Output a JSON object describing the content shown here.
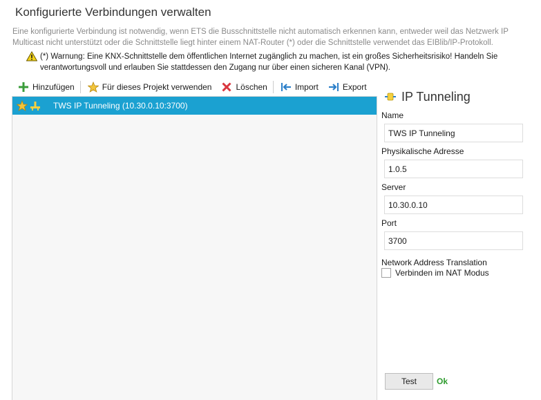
{
  "page": {
    "title": "Konfigurierte Verbindungen verwalten",
    "description": "Eine konfigurierte Verbindung ist notwendig, wenn ETS die Busschnittstelle nicht automatisch erkennen kann, entweder weil das Netzwerk IP Multicast nicht unterstützt oder die Schnittstelle liegt hinter einem NAT-Router (*) oder die Schnittstelle verwendet das EIBlib/IP-Protokoll.",
    "warning": "(*) Warnung: Eine KNX-Schnittstelle dem öffentlichen Internet zugänglich zu machen, ist ein großes Sicherheitsrisiko! Handeln Sie verantwortungsvoll und erlauben Sie stattdessen den Zugang nur über einen sicheren Kanal (VPN)."
  },
  "toolbar": {
    "add": "Hinzufügen",
    "use_for_project": "Für dieses Projekt verwenden",
    "delete": "Löschen",
    "import": "Import",
    "export": "Export"
  },
  "connections": [
    {
      "label": "TWS IP Tunneling (10.30.0.10:3700)",
      "selected": true,
      "is_favorite": true
    }
  ],
  "details": {
    "title": "IP Tunneling",
    "name_label": "Name",
    "name_value": "TWS IP Tunneling",
    "phys_label": "Physikalische Adresse",
    "phys_value": "1.0.5",
    "server_label": "Server",
    "server_value": "10.30.0.10",
    "port_label": "Port",
    "port_value": "3700",
    "nat_label": "Network Address Translation",
    "nat_checkbox_label": "Verbinden im NAT Modus",
    "nat_checked": false,
    "test_button": "Test",
    "test_result": "Ok"
  },
  "colors": {
    "selection": "#1ba1d1",
    "ok_green": "#2e9b2e",
    "add_green": "#3a9c3a",
    "delete_red": "#d9363e",
    "arrow_blue": "#2b7fc9"
  }
}
